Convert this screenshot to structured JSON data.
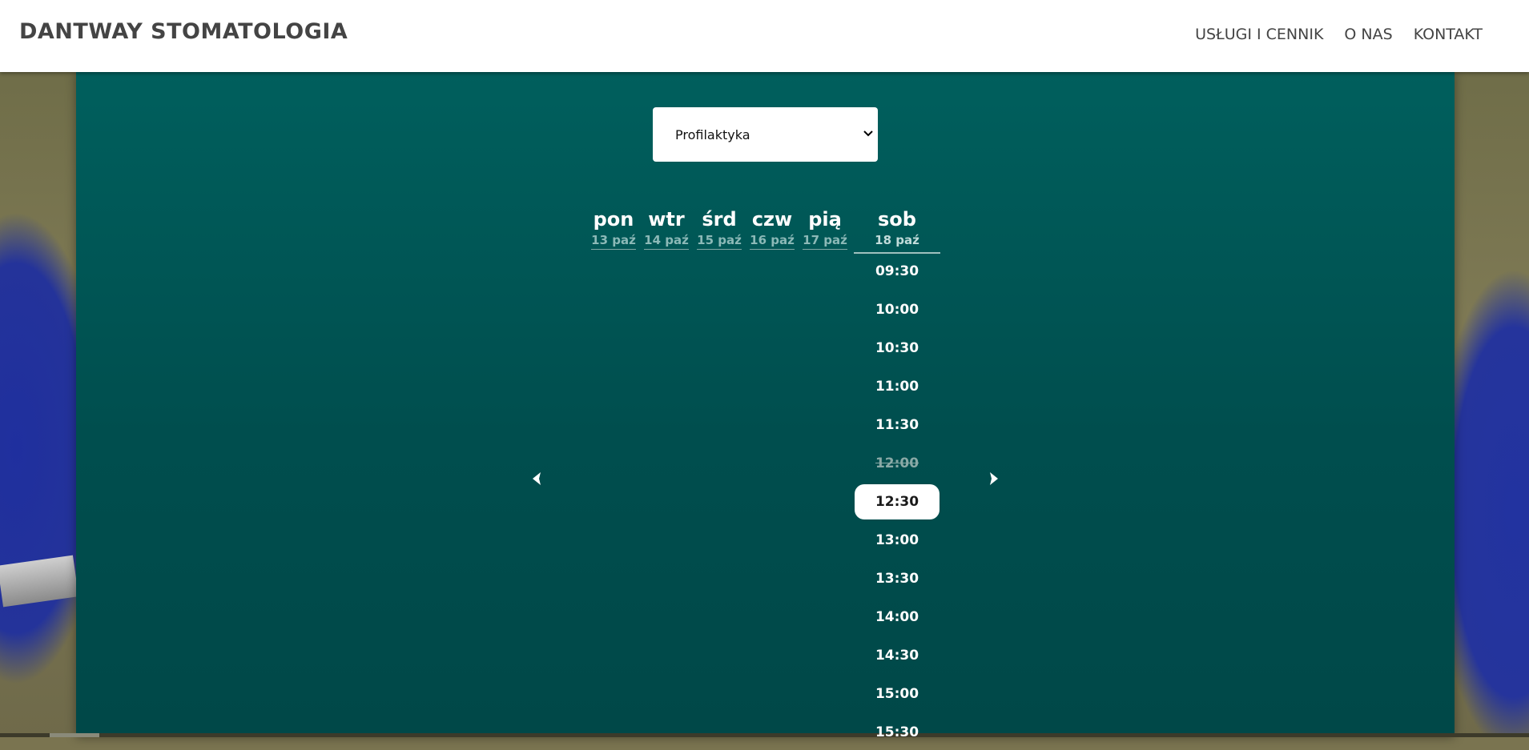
{
  "header": {
    "brand": "DANTWAY STOMATOLOGIA",
    "nav": [
      "USŁUGI I CENNIK",
      "O NAS",
      "KONTAKT"
    ]
  },
  "booking": {
    "service_select": {
      "value": "Profilaktyka",
      "options": [
        "Profilaktyka"
      ]
    },
    "days": [
      {
        "name": "pon",
        "date": "13 paź"
      },
      {
        "name": "wtr",
        "date": "14 paź"
      },
      {
        "name": "śrd",
        "date": "15 paź"
      },
      {
        "name": "czw",
        "date": "16 paź"
      },
      {
        "name": "pią",
        "date": "17 paź"
      },
      {
        "name": "sob",
        "date": "18 paź"
      }
    ],
    "active_day_index": 5,
    "slots": [
      {
        "time": "09:30",
        "state": "available"
      },
      {
        "time": "10:00",
        "state": "available"
      },
      {
        "time": "10:30",
        "state": "available"
      },
      {
        "time": "11:00",
        "state": "available"
      },
      {
        "time": "11:30",
        "state": "available"
      },
      {
        "time": "12:00",
        "state": "unavailable"
      },
      {
        "time": "12:30",
        "state": "selected"
      },
      {
        "time": "13:00",
        "state": "available"
      },
      {
        "time": "13:30",
        "state": "available"
      },
      {
        "time": "14:00",
        "state": "available"
      },
      {
        "time": "14:30",
        "state": "available"
      },
      {
        "time": "15:00",
        "state": "available"
      },
      {
        "time": "15:30",
        "state": "available"
      }
    ],
    "prev_icon": "chevron-left-icon",
    "next_icon": "chevron-right-icon"
  },
  "colors": {
    "panel": "#005a58",
    "header_bg": "#ffffff",
    "brand_text": "#444444"
  }
}
